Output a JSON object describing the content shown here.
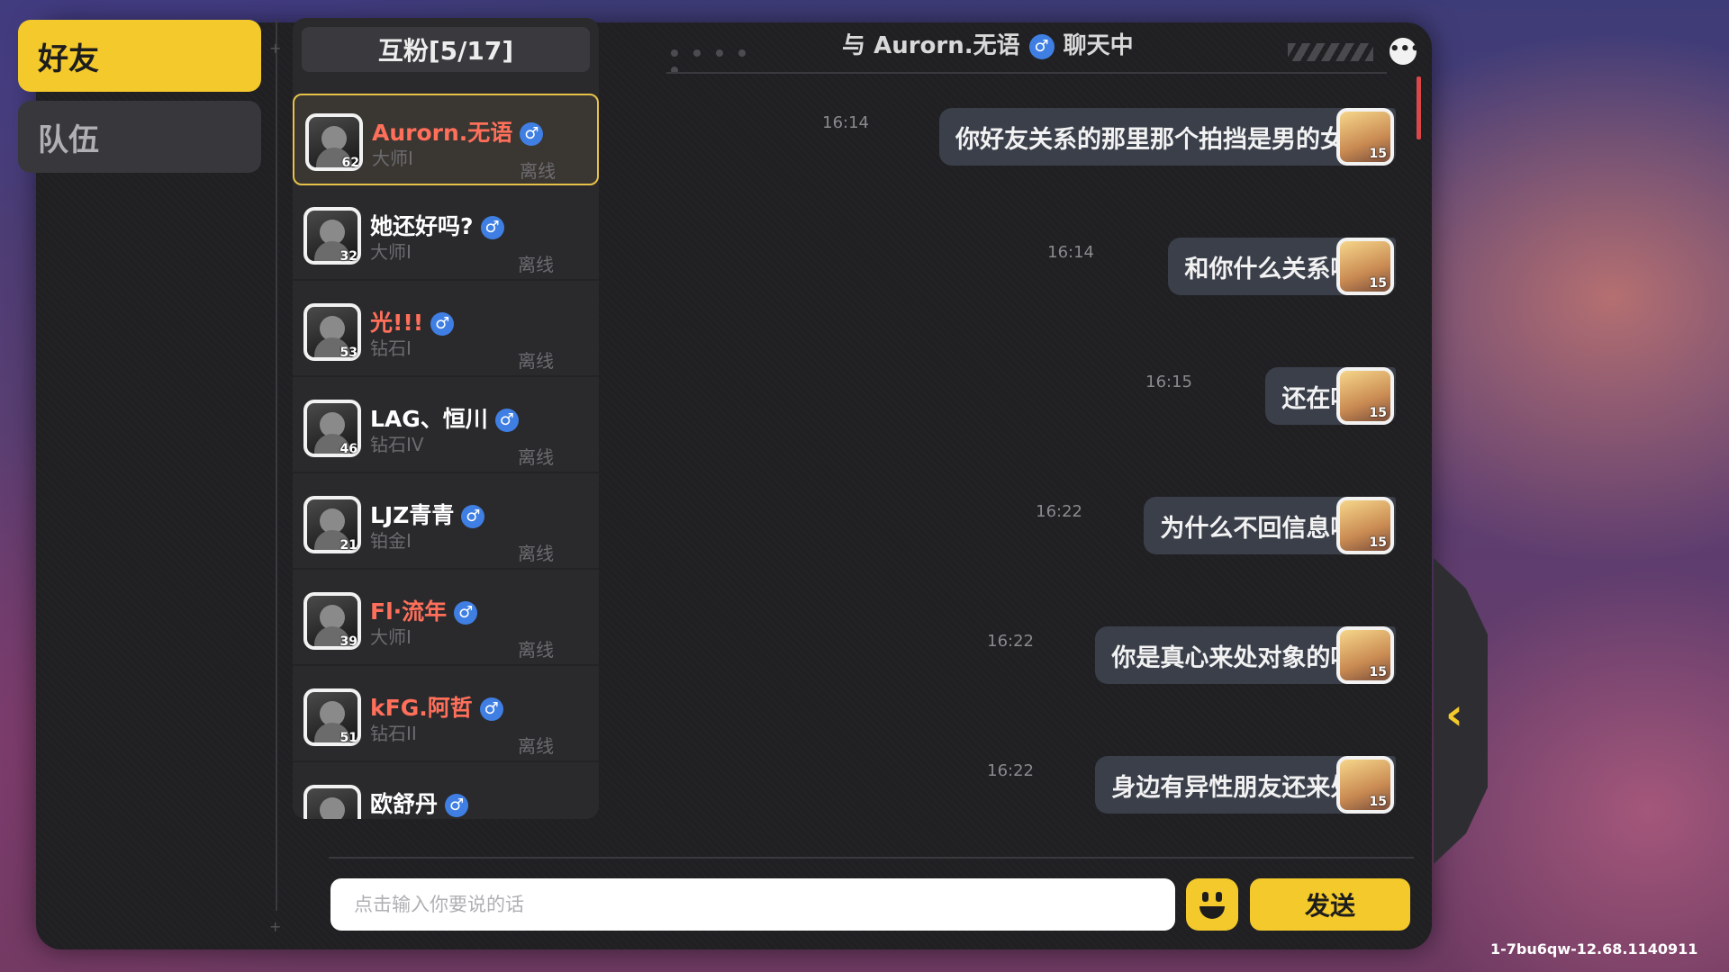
{
  "tabs": {
    "friends": "好友",
    "team": "队伍"
  },
  "friend_list": {
    "header": "互粉[5/17]",
    "friends": [
      {
        "name": "Aurorn.无语",
        "level": "62",
        "rank": "大师I",
        "status": "离线",
        "gender": "♂"
      },
      {
        "name": "她还好吗?",
        "level": "32",
        "rank": "大师I",
        "status": "离线",
        "gender": "♂"
      },
      {
        "name": "光!!!",
        "level": "53",
        "rank": "钻石I",
        "status": "离线",
        "gender": "♂"
      },
      {
        "name": "LAG、恒川",
        "level": "46",
        "rank": "钻石IV",
        "status": "离线",
        "gender": "♂"
      },
      {
        "name": "LJZ青青",
        "level": "21",
        "rank": "铂金I",
        "status": "离线",
        "gender": "♂"
      },
      {
        "name": "Fl·流年",
        "level": "39",
        "rank": "大师I",
        "status": "离线",
        "gender": "♂"
      },
      {
        "name": "kFG.阿哲",
        "level": "51",
        "rank": "钻石II",
        "status": "离线",
        "gender": "♂"
      },
      {
        "name": "欧舒丹",
        "level": "",
        "rank": "",
        "status": "",
        "gender": "♂"
      }
    ]
  },
  "chat": {
    "title_prefix": "与",
    "partner": "Aurorn.无语",
    "gender": "♂",
    "title_suffix": "聊天中",
    "more_icon": "•••",
    "my_level": "15",
    "messages": [
      {
        "time": "16:14",
        "text": "你好友关系的那里那个拍挡是男的女的"
      },
      {
        "time": "16:14",
        "text": "和你什么关系啊?"
      },
      {
        "time": "16:15",
        "text": "还在吗?"
      },
      {
        "time": "16:22",
        "text": "为什么不回信息啊?"
      },
      {
        "time": "16:22",
        "text": "你是真心来处对象的吗?"
      },
      {
        "time": "16:22",
        "text": "身边有异性朋友还来处?"
      }
    ]
  },
  "input": {
    "placeholder": "点击输入你要说的话",
    "value": ""
  },
  "send_label": "发送",
  "side_arrow": "‹",
  "version": "1-7bu6qw-12.68.1140911",
  "colors": {
    "accent": "#f4c92b",
    "panel": "#202023",
    "bubble": "#3a3f4a",
    "name_red": "#ff6f5a",
    "gender_blue": "#3f7fe3"
  }
}
